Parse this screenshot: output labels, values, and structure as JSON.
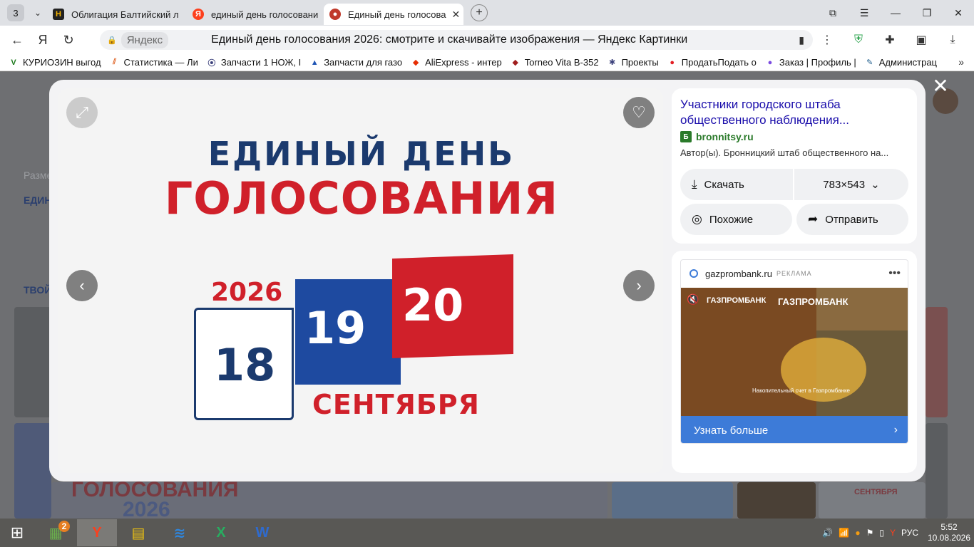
{
  "browser": {
    "tab_count": "3",
    "tabs": [
      {
        "label": "Облигация Балтийский л",
        "favicon": "H",
        "fav_color": "#222222"
      },
      {
        "label": "единый день голосовани",
        "favicon": "Я",
        "fav_color": "#fc3f1d"
      },
      {
        "label": "Единый день голосова",
        "favicon": "●",
        "fav_color": "#c0392b"
      }
    ],
    "url_host": "Яндекс",
    "page_title": "Единый день голосования 2026: смотрите и скачивайте изображения — Яндекс Картинки",
    "bookmarks": [
      {
        "label": "КУРИОЗИН выгод",
        "icon": "V",
        "color": "#1e7b1e"
      },
      {
        "label": "Статистика — Ли",
        "icon": "⫽",
        "color": "#e0672a"
      },
      {
        "label": "Запчасти 1 НОЖ, I",
        "icon": "⦿",
        "color": "#3a3f7a"
      },
      {
        "label": "Запчасти для газо",
        "icon": "▲",
        "color": "#1f55b5"
      },
      {
        "label": "AliExpress - интер",
        "icon": "◆",
        "color": "#e62e04"
      },
      {
        "label": "Torneo Vita B-352",
        "icon": "◆",
        "color": "#a01e1e"
      },
      {
        "label": "Проекты",
        "icon": "✱",
        "color": "#3a3f7a"
      },
      {
        "label": "ПродатьПодать о",
        "icon": "●",
        "color": "#e31e24"
      },
      {
        "label": "Заказ | Профиль |",
        "icon": "●",
        "color": "#7b4be0"
      },
      {
        "label": "Администрац",
        "icon": "✎",
        "color": "#1a5a8a"
      }
    ]
  },
  "background_page": {
    "texts": [
      "Разме",
      "ЕДИН",
      "ТВОЙ"
    ],
    "partial_labels": [
      "ГОЛОСОВАНИЯ",
      "2026",
      "СЕНТЯБРЯ"
    ]
  },
  "viewer": {
    "poster": {
      "line1": "ЕДИНЫЙ ДЕНЬ",
      "line2": "ГОЛОСОВАНИЯ",
      "year": "2026",
      "day1": "18",
      "day2": "19",
      "day3": "20",
      "month": "СЕНТЯБРЯ"
    },
    "info": {
      "title": "Участники городского штаба общественного наблюдения...",
      "source_host": "bronnitsy.ru",
      "author": "Автор(ы). Бронницкий штаб общественного на...",
      "download_label": "Скачать",
      "size_label": "783×543",
      "similar_label": "Похожие",
      "share_label": "Отправить"
    },
    "ad": {
      "host": "gazprombank.ru",
      "tag": "РЕКЛАМА",
      "brand": "ГАЗПРОМБАНК",
      "caption": "Накопительный счет в Газпромбанке",
      "cta": "Узнать больше"
    }
  },
  "taskbar": {
    "language": "РУС",
    "time": "5:52",
    "date": "10.08.2026",
    "badge": "2"
  }
}
